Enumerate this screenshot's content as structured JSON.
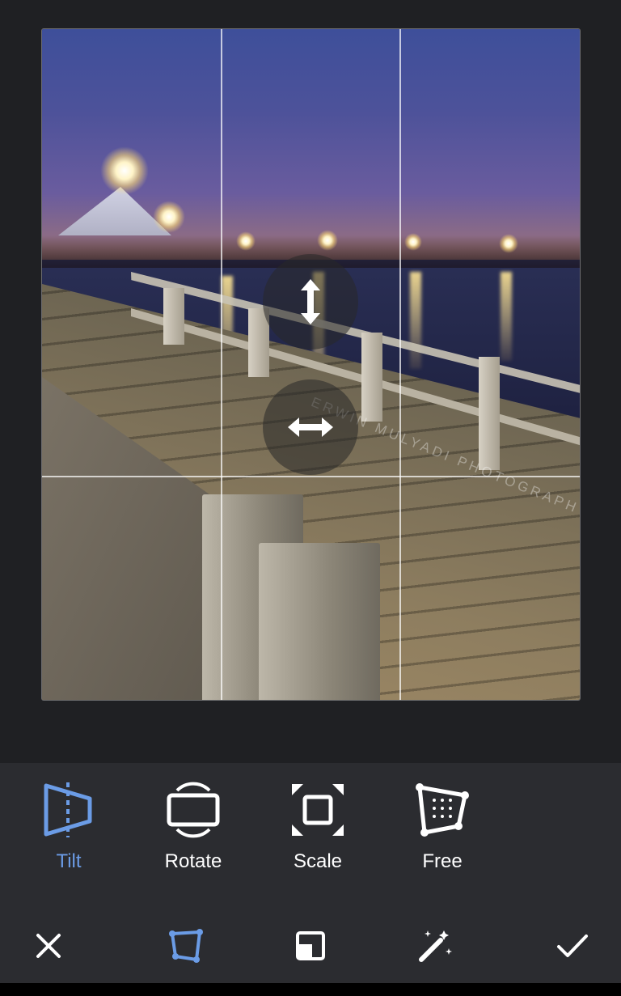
{
  "photo": {
    "watermark": "ERWIN MULYADI PHOTOGRAPHY"
  },
  "handles": {
    "vertical": "vertical-tilt-handle",
    "horizontal": "horizontal-tilt-handle"
  },
  "tools": [
    {
      "label": "Tilt",
      "icon": "tilt-icon",
      "active": true
    },
    {
      "label": "Rotate",
      "icon": "rotate-icon",
      "active": false
    },
    {
      "label": "Scale",
      "icon": "scale-icon",
      "active": false
    },
    {
      "label": "Free",
      "icon": "free-transform-icon",
      "active": false
    }
  ],
  "actions": [
    {
      "icon": "close-icon"
    },
    {
      "icon": "perspective-icon"
    },
    {
      "icon": "crop-icon"
    },
    {
      "icon": "magic-wand-icon"
    },
    {
      "icon": "check-icon"
    }
  ],
  "colors": {
    "accent": "#6b9ce6",
    "background": "#1f2023",
    "toolbar": "#2b2c30",
    "text": "#ffffff"
  }
}
